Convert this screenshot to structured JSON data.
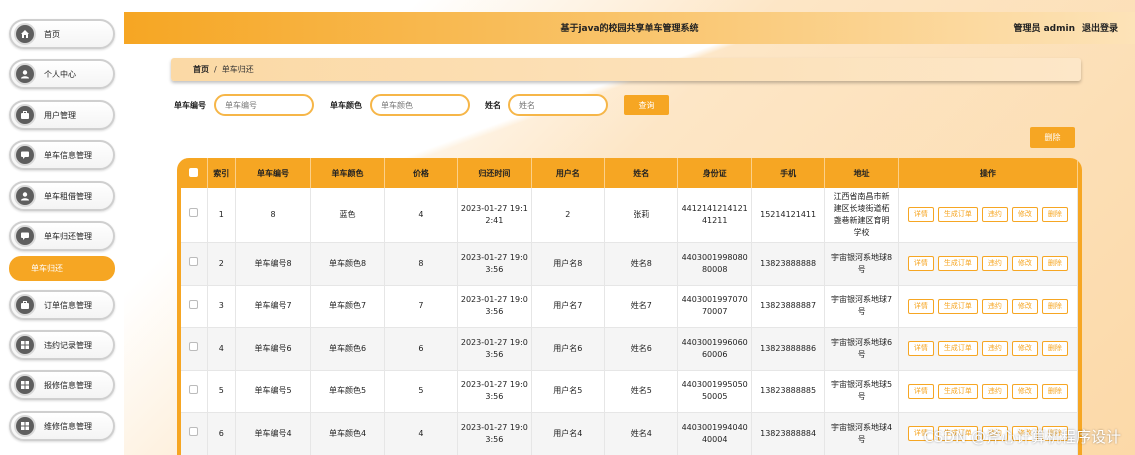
{
  "header": {
    "title": "基于java的校园共享单车管理系统",
    "user": "管理员 admin",
    "logout": "退出登录"
  },
  "sidebar": {
    "items": [
      {
        "label": "首页",
        "icon": "home-icon"
      },
      {
        "label": "个人中心",
        "icon": "user-icon"
      },
      {
        "label": "用户管理",
        "icon": "briefcase-icon"
      },
      {
        "label": "单车信息管理",
        "icon": "chat-icon"
      },
      {
        "label": "单车租借管理",
        "icon": "user-icon"
      },
      {
        "label": "单车归还管理",
        "icon": "chat-icon"
      },
      {
        "label": "订单信息管理",
        "icon": "briefcase-icon"
      },
      {
        "label": "违约记录管理",
        "icon": "grid-icon"
      },
      {
        "label": "报修信息管理",
        "icon": "grid-icon"
      },
      {
        "label": "维修信息管理",
        "icon": "grid-icon"
      }
    ],
    "active_sub": "单车归还"
  },
  "breadcrumb": {
    "home": "首页",
    "sep": "/",
    "current": "单车归还"
  },
  "search": {
    "bike_no_label": "单车编号",
    "bike_no_placeholder": "单车编号",
    "bike_color_label": "单车颜色",
    "bike_color_placeholder": "单车颜色",
    "name_label": "姓名",
    "name_placeholder": "姓名",
    "query_button": "查询"
  },
  "delete_button": "删除",
  "table": {
    "columns": [
      "索引",
      "单车编号",
      "单车颜色",
      "价格",
      "归还时间",
      "用户名",
      "姓名",
      "身份证",
      "手机",
      "地址",
      "操作"
    ],
    "rows": [
      {
        "index": "1",
        "bike_no": "8",
        "color": "蓝色",
        "price": "4",
        "time": "2023-01-27 19:12:41",
        "username": "2",
        "name": "张莉",
        "id_card": "441214121412141211",
        "phone": "15214121411",
        "address": "江西省南昌市新建区长堎街道柘盏巷新建区育明学校"
      },
      {
        "index": "2",
        "bike_no": "单车编号8",
        "color": "单车颜色8",
        "price": "8",
        "time": "2023-01-27 19:03:56",
        "username": "用户名8",
        "name": "姓名8",
        "id_card": "440300199808080008",
        "phone": "13823888888",
        "address": "宇宙银河系地球8号"
      },
      {
        "index": "3",
        "bike_no": "单车编号7",
        "color": "单车颜色7",
        "price": "7",
        "time": "2023-01-27 19:03:56",
        "username": "用户名7",
        "name": "姓名7",
        "id_card": "440300199707070007",
        "phone": "13823888887",
        "address": "宇宙银河系地球7号"
      },
      {
        "index": "4",
        "bike_no": "单车编号6",
        "color": "单车颜色6",
        "price": "6",
        "time": "2023-01-27 19:03:56",
        "username": "用户名6",
        "name": "姓名6",
        "id_card": "440300199606060006",
        "phone": "13823888886",
        "address": "宇宙银河系地球6号"
      },
      {
        "index": "5",
        "bike_no": "单车编号5",
        "color": "单车颜色5",
        "price": "5",
        "time": "2023-01-27 19:03:56",
        "username": "用户名5",
        "name": "姓名5",
        "id_card": "440300199505050005",
        "phone": "13823888885",
        "address": "宇宙银河系地球5号"
      },
      {
        "index": "6",
        "bike_no": "单车编号4",
        "color": "单车颜色4",
        "price": "4",
        "time": "2023-01-27 19:03:56",
        "username": "用户名4",
        "name": "姓名4",
        "id_card": "440300199404040004",
        "phone": "13823888884",
        "address": "宇宙银河系地球4号"
      }
    ],
    "actions": [
      "详情",
      "生成订单",
      "违约",
      "修改",
      "删除"
    ]
  },
  "watermark": "CSDN @斧心计算机程序设计",
  "colors": {
    "accent": "#f6a623",
    "sidebar_icon": "#5e5e5e"
  }
}
